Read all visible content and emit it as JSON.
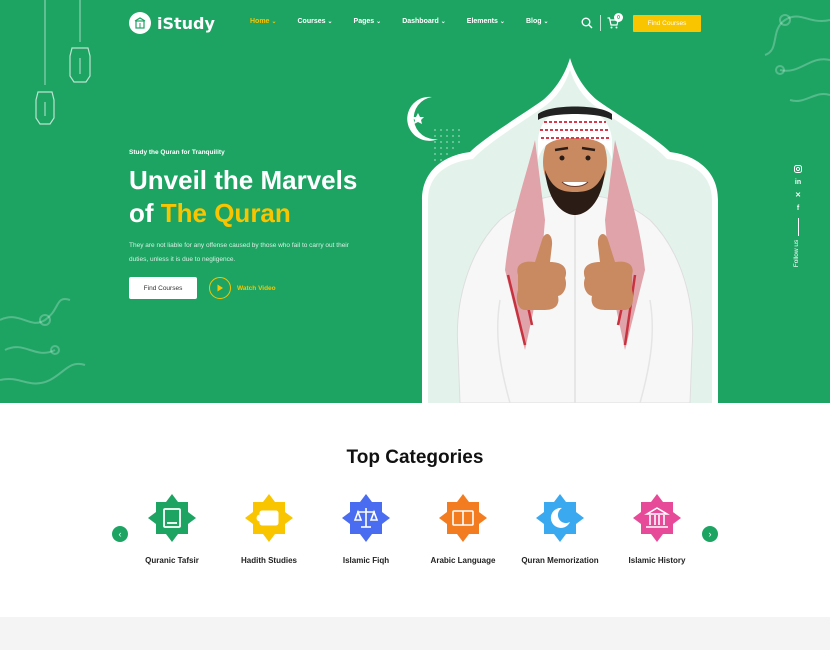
{
  "brand": {
    "name": "iStudy"
  },
  "nav": [
    {
      "label": "Home",
      "active": true
    },
    {
      "label": "Courses"
    },
    {
      "label": "Pages"
    },
    {
      "label": "Dashboard"
    },
    {
      "label": "Elements"
    },
    {
      "label": "Blog"
    }
  ],
  "header": {
    "cart_count": "0",
    "cta": "Find Courses"
  },
  "hero": {
    "eyebrow": "Study the Quran for Tranquility",
    "title_line1": "Unveil the Marvels",
    "title_line2_prefix": "of ",
    "title_accent": "The Quran",
    "description": "They are not liable for any offense caused by those who fail to carry out their duties, unless it is due to negligence.",
    "cta_primary": "Find Courses",
    "cta_video": "Watch Video"
  },
  "social": {
    "follow_label": "Follow us",
    "icons": [
      "instagram-icon",
      "linkedin-icon",
      "x-icon",
      "facebook-icon"
    ]
  },
  "categories": {
    "title": "Top Categories",
    "items": [
      {
        "label": "Quranic Tafsir",
        "color": "#1da463",
        "icon": "book-icon"
      },
      {
        "label": "Hadith Studies",
        "color": "#f9c400",
        "icon": "scroll-icon"
      },
      {
        "label": "Islamic Fiqh",
        "color": "#4a6cf0",
        "icon": "scales-icon"
      },
      {
        "label": "Arabic Language",
        "color": "#f47c20",
        "icon": "language-icon"
      },
      {
        "label": "Quran Memorization",
        "color": "#3aa9f0",
        "icon": "crescent-icon"
      },
      {
        "label": "Islamic History",
        "color": "#e84a9a",
        "icon": "building-icon"
      }
    ]
  },
  "colors": {
    "primary": "#1da463",
    "accent": "#f9c400"
  }
}
